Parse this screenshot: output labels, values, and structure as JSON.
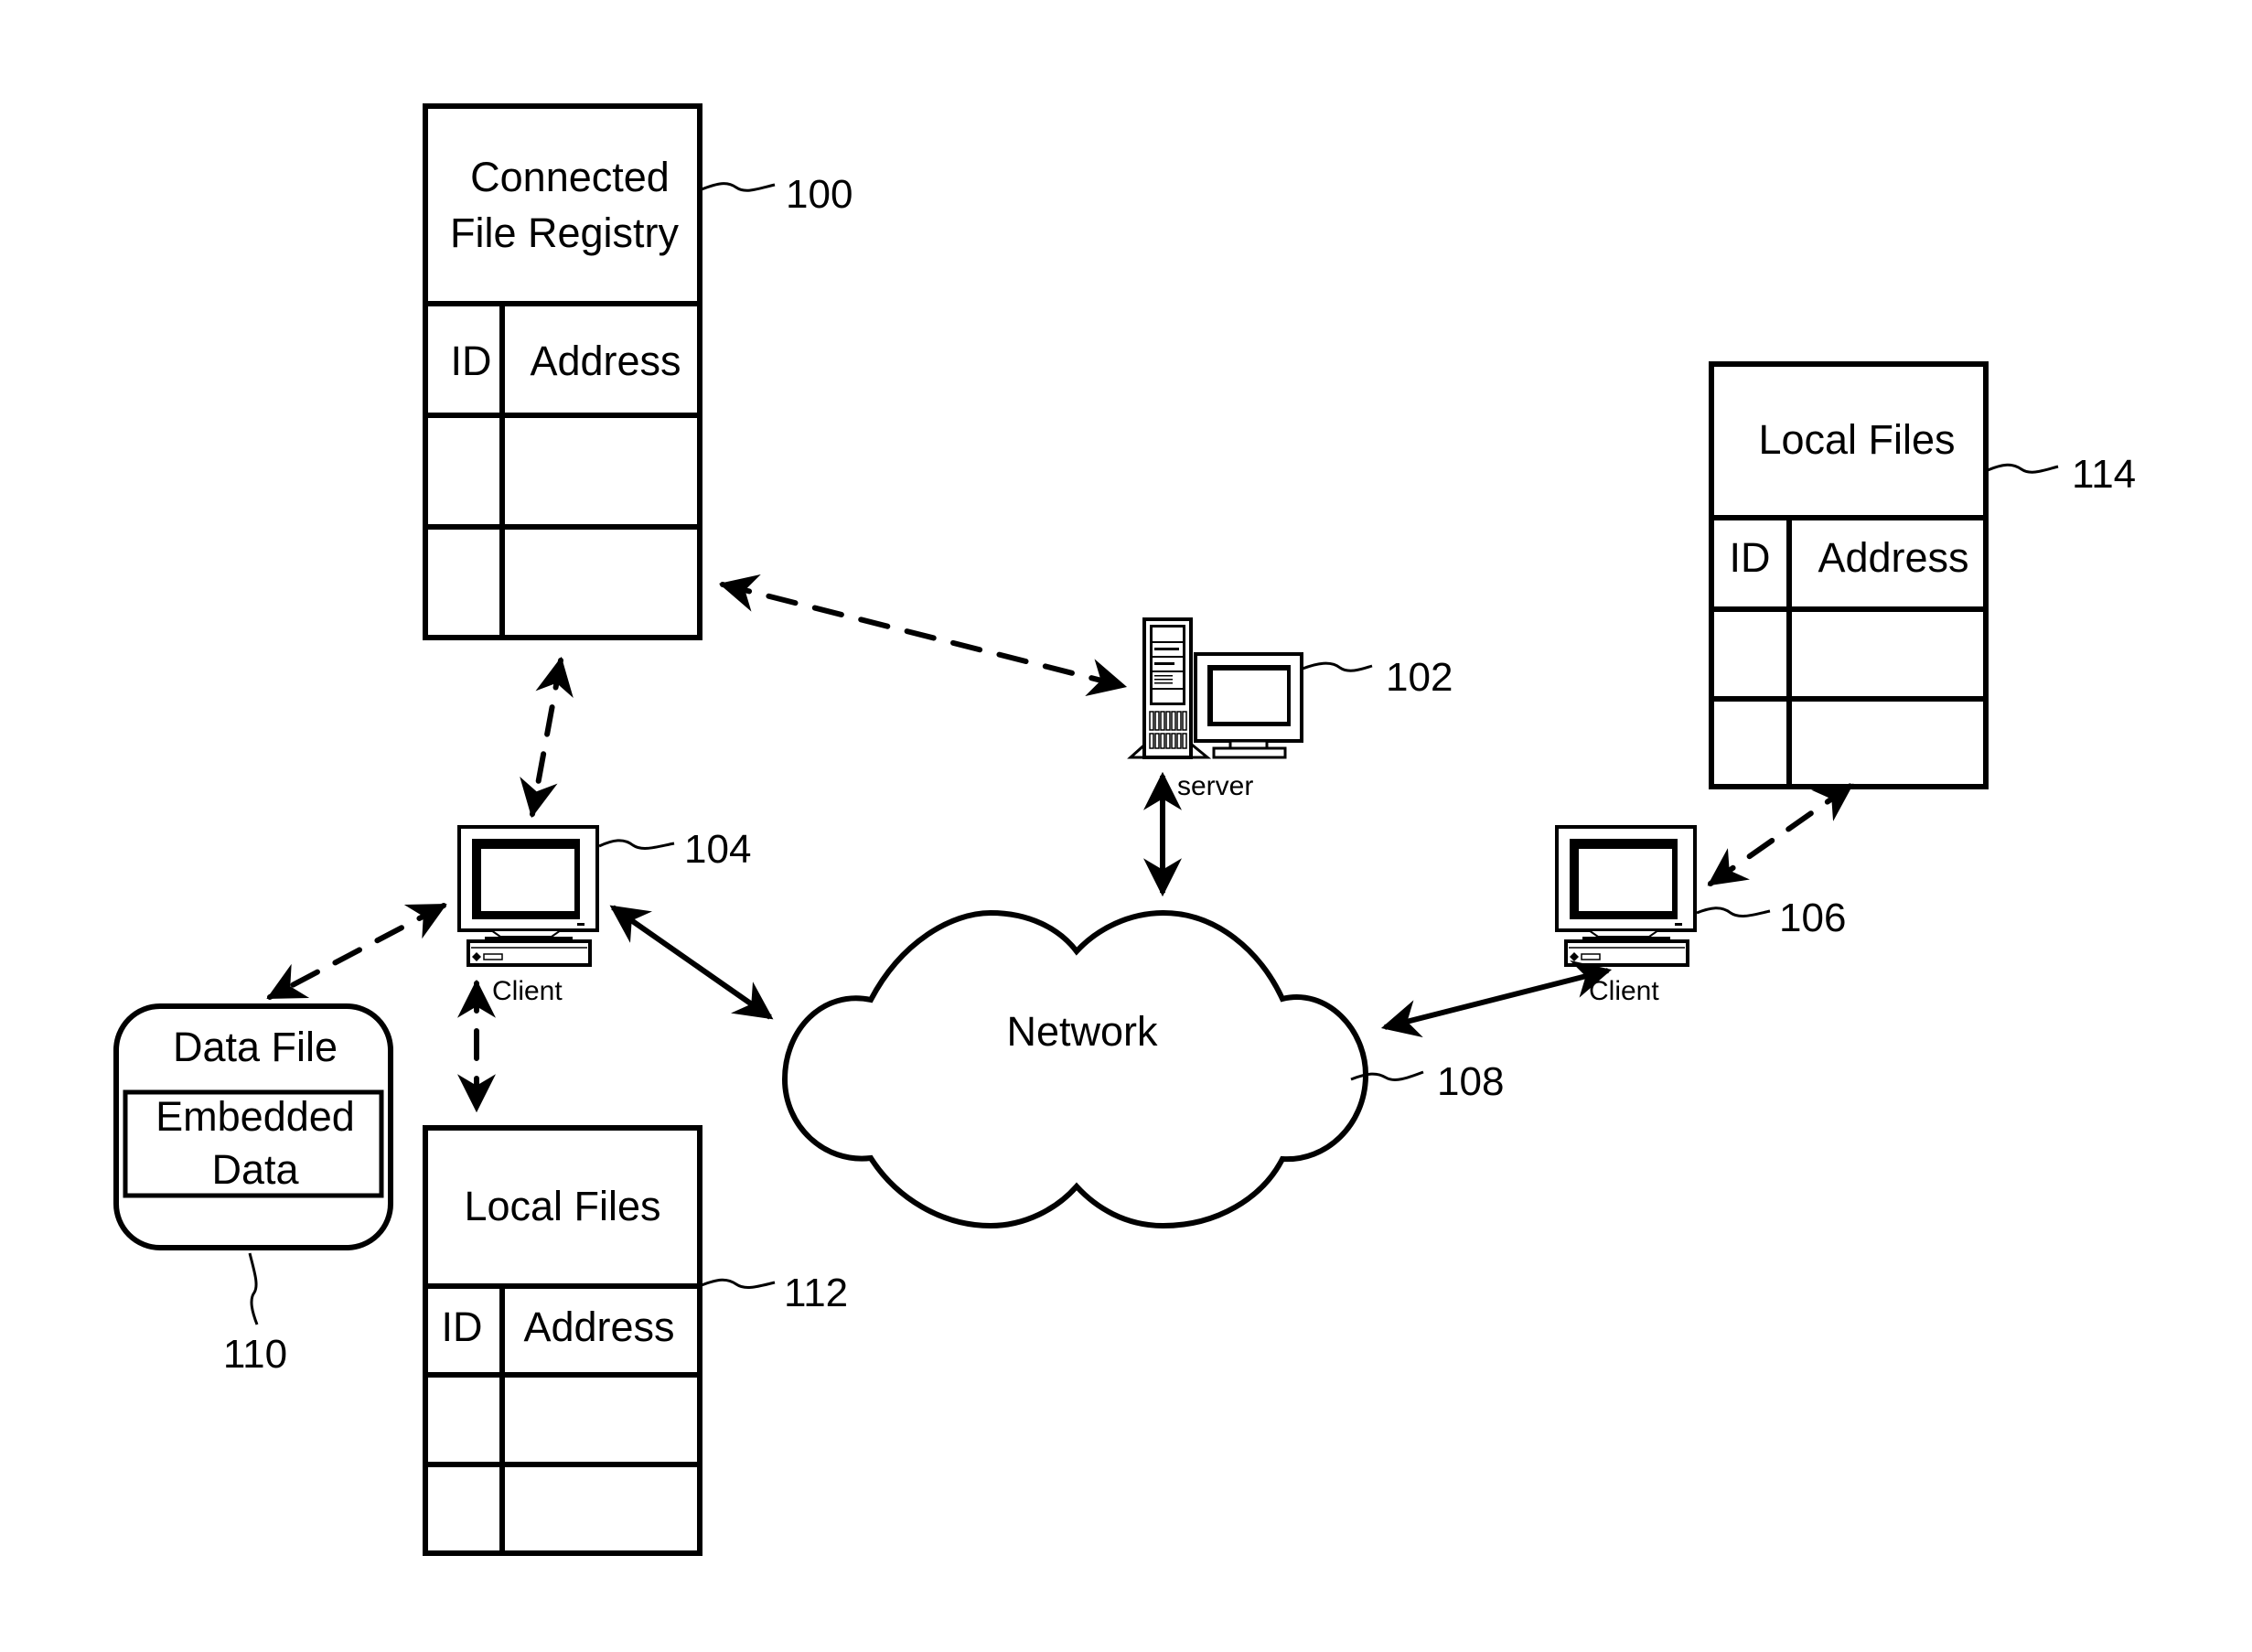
{
  "diagram": {
    "registry": {
      "title_line1": "Connected",
      "title_line2": "File Registry",
      "col_id": "ID",
      "col_address": "Address",
      "ref": "100",
      "rows": [
        [
          "",
          ""
        ],
        [
          "",
          ""
        ]
      ]
    },
    "server": {
      "label": "server",
      "ref": "102"
    },
    "client_left": {
      "label": "Client",
      "ref": "104"
    },
    "client_right": {
      "label": "Client",
      "ref": "106"
    },
    "network": {
      "label": "Network",
      "ref": "108"
    },
    "data_file": {
      "title": "Data File",
      "embedded_line1": "Embedded",
      "embedded_line2": "Data",
      "ref": "110"
    },
    "local_files_left": {
      "title": "Local Files",
      "col_id": "ID",
      "col_address": "Address",
      "ref": "112",
      "rows": [
        [
          "",
          ""
        ],
        [
          "",
          ""
        ]
      ]
    },
    "local_files_right": {
      "title": "Local Files",
      "col_id": "ID",
      "col_address": "Address",
      "ref": "114",
      "rows": [
        [
          "",
          ""
        ],
        [
          "",
          ""
        ]
      ]
    },
    "connections": [
      {
        "from": "registry",
        "to": "server",
        "style": "dashed",
        "arrows": "both"
      },
      {
        "from": "registry",
        "to": "client_left",
        "style": "dashed",
        "arrows": "both"
      },
      {
        "from": "client_left",
        "to": "data_file",
        "style": "dashed",
        "arrows": "both"
      },
      {
        "from": "client_left",
        "to": "local_files_left",
        "style": "dashed",
        "arrows": "both"
      },
      {
        "from": "client_left",
        "to": "network",
        "style": "solid",
        "arrows": "both"
      },
      {
        "from": "server",
        "to": "network",
        "style": "solid",
        "arrows": "both"
      },
      {
        "from": "client_right",
        "to": "network",
        "style": "solid",
        "arrows": "both"
      },
      {
        "from": "client_right",
        "to": "local_files_right",
        "style": "dashed",
        "arrows": "both"
      }
    ]
  }
}
